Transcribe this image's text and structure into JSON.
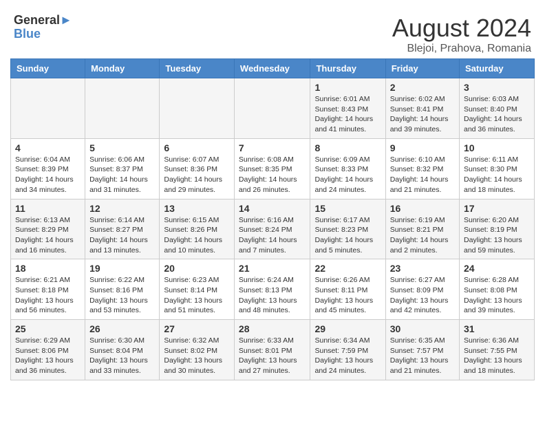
{
  "logo": {
    "line1": "General",
    "line2": "Blue"
  },
  "title": "August 2024",
  "subtitle": "Blejoi, Prahova, Romania",
  "weekdays": [
    "Sunday",
    "Monday",
    "Tuesday",
    "Wednesday",
    "Thursday",
    "Friday",
    "Saturday"
  ],
  "weeks": [
    [
      {
        "day": "",
        "info": ""
      },
      {
        "day": "",
        "info": ""
      },
      {
        "day": "",
        "info": ""
      },
      {
        "day": "",
        "info": ""
      },
      {
        "day": "1",
        "info": "Sunrise: 6:01 AM\nSunset: 8:43 PM\nDaylight: 14 hours and 41 minutes."
      },
      {
        "day": "2",
        "info": "Sunrise: 6:02 AM\nSunset: 8:41 PM\nDaylight: 14 hours and 39 minutes."
      },
      {
        "day": "3",
        "info": "Sunrise: 6:03 AM\nSunset: 8:40 PM\nDaylight: 14 hours and 36 minutes."
      }
    ],
    [
      {
        "day": "4",
        "info": "Sunrise: 6:04 AM\nSunset: 8:39 PM\nDaylight: 14 hours and 34 minutes."
      },
      {
        "day": "5",
        "info": "Sunrise: 6:06 AM\nSunset: 8:37 PM\nDaylight: 14 hours and 31 minutes."
      },
      {
        "day": "6",
        "info": "Sunrise: 6:07 AM\nSunset: 8:36 PM\nDaylight: 14 hours and 29 minutes."
      },
      {
        "day": "7",
        "info": "Sunrise: 6:08 AM\nSunset: 8:35 PM\nDaylight: 14 hours and 26 minutes."
      },
      {
        "day": "8",
        "info": "Sunrise: 6:09 AM\nSunset: 8:33 PM\nDaylight: 14 hours and 24 minutes."
      },
      {
        "day": "9",
        "info": "Sunrise: 6:10 AM\nSunset: 8:32 PM\nDaylight: 14 hours and 21 minutes."
      },
      {
        "day": "10",
        "info": "Sunrise: 6:11 AM\nSunset: 8:30 PM\nDaylight: 14 hours and 18 minutes."
      }
    ],
    [
      {
        "day": "11",
        "info": "Sunrise: 6:13 AM\nSunset: 8:29 PM\nDaylight: 14 hours and 16 minutes."
      },
      {
        "day": "12",
        "info": "Sunrise: 6:14 AM\nSunset: 8:27 PM\nDaylight: 14 hours and 13 minutes."
      },
      {
        "day": "13",
        "info": "Sunrise: 6:15 AM\nSunset: 8:26 PM\nDaylight: 14 hours and 10 minutes."
      },
      {
        "day": "14",
        "info": "Sunrise: 6:16 AM\nSunset: 8:24 PM\nDaylight: 14 hours and 7 minutes."
      },
      {
        "day": "15",
        "info": "Sunrise: 6:17 AM\nSunset: 8:23 PM\nDaylight: 14 hours and 5 minutes."
      },
      {
        "day": "16",
        "info": "Sunrise: 6:19 AM\nSunset: 8:21 PM\nDaylight: 14 hours and 2 minutes."
      },
      {
        "day": "17",
        "info": "Sunrise: 6:20 AM\nSunset: 8:19 PM\nDaylight: 13 hours and 59 minutes."
      }
    ],
    [
      {
        "day": "18",
        "info": "Sunrise: 6:21 AM\nSunset: 8:18 PM\nDaylight: 13 hours and 56 minutes."
      },
      {
        "day": "19",
        "info": "Sunrise: 6:22 AM\nSunset: 8:16 PM\nDaylight: 13 hours and 53 minutes."
      },
      {
        "day": "20",
        "info": "Sunrise: 6:23 AM\nSunset: 8:14 PM\nDaylight: 13 hours and 51 minutes."
      },
      {
        "day": "21",
        "info": "Sunrise: 6:24 AM\nSunset: 8:13 PM\nDaylight: 13 hours and 48 minutes."
      },
      {
        "day": "22",
        "info": "Sunrise: 6:26 AM\nSunset: 8:11 PM\nDaylight: 13 hours and 45 minutes."
      },
      {
        "day": "23",
        "info": "Sunrise: 6:27 AM\nSunset: 8:09 PM\nDaylight: 13 hours and 42 minutes."
      },
      {
        "day": "24",
        "info": "Sunrise: 6:28 AM\nSunset: 8:08 PM\nDaylight: 13 hours and 39 minutes."
      }
    ],
    [
      {
        "day": "25",
        "info": "Sunrise: 6:29 AM\nSunset: 8:06 PM\nDaylight: 13 hours and 36 minutes."
      },
      {
        "day": "26",
        "info": "Sunrise: 6:30 AM\nSunset: 8:04 PM\nDaylight: 13 hours and 33 minutes."
      },
      {
        "day": "27",
        "info": "Sunrise: 6:32 AM\nSunset: 8:02 PM\nDaylight: 13 hours and 30 minutes."
      },
      {
        "day": "28",
        "info": "Sunrise: 6:33 AM\nSunset: 8:01 PM\nDaylight: 13 hours and 27 minutes."
      },
      {
        "day": "29",
        "info": "Sunrise: 6:34 AM\nSunset: 7:59 PM\nDaylight: 13 hours and 24 minutes."
      },
      {
        "day": "30",
        "info": "Sunrise: 6:35 AM\nSunset: 7:57 PM\nDaylight: 13 hours and 21 minutes."
      },
      {
        "day": "31",
        "info": "Sunrise: 6:36 AM\nSunset: 7:55 PM\nDaylight: 13 hours and 18 minutes."
      }
    ]
  ],
  "colors": {
    "header_bg": "#4a86c8",
    "header_text": "#ffffff",
    "odd_row": "#f5f5f5",
    "even_row": "#ffffff"
  }
}
